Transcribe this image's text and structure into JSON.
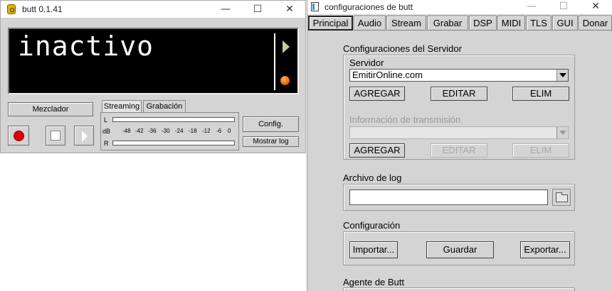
{
  "main_window": {
    "title": "butt 0.1.41",
    "controls": {
      "minimize": "—",
      "maximize": "☐",
      "close": "✕"
    },
    "display_text": "inactivo",
    "mixer_label": "Mezclador",
    "tabs": [
      "Streaming",
      "Grabación"
    ],
    "vu": {
      "top_channel": "L",
      "scale_unit": "dB",
      "bottom_channel": "R",
      "ticks": [
        "-48",
        "-42",
        "-36",
        "-30",
        "-24",
        "-18",
        "-12",
        "-6",
        "0"
      ]
    },
    "config_label": "Config.",
    "show_log_label": "Mostrar log"
  },
  "config_window": {
    "title": "configuraciones de butt",
    "controls": {
      "minimize": "—",
      "maximize": "☐",
      "close": "✕"
    },
    "tabs": [
      "Principal",
      "Audio",
      "Stream",
      "Grabar",
      "DSP",
      "MIDI",
      "TLS",
      "GUI",
      "Donar"
    ],
    "active_tab": "Principal",
    "server_settings": {
      "title": "Configuraciones del Servidor",
      "server_label": "Servidor",
      "server_value": "EmitirOnline.com",
      "buttons": [
        "AGREGAR",
        "EDITAR",
        "ELIM"
      ],
      "stream_info_label": "Información de transmisión",
      "stream_info_value": "",
      "stream_info_buttons": [
        "AGREGAR",
        "EDITAR",
        "ELIM"
      ]
    },
    "log_file": {
      "title": "Archivo de log",
      "value": ""
    },
    "configuration": {
      "title": "Configuración",
      "import_label": "Importar...",
      "save_label": "Guardar",
      "export_label": "Exportar..."
    },
    "agent": {
      "title": "Agente de Butt"
    }
  }
}
